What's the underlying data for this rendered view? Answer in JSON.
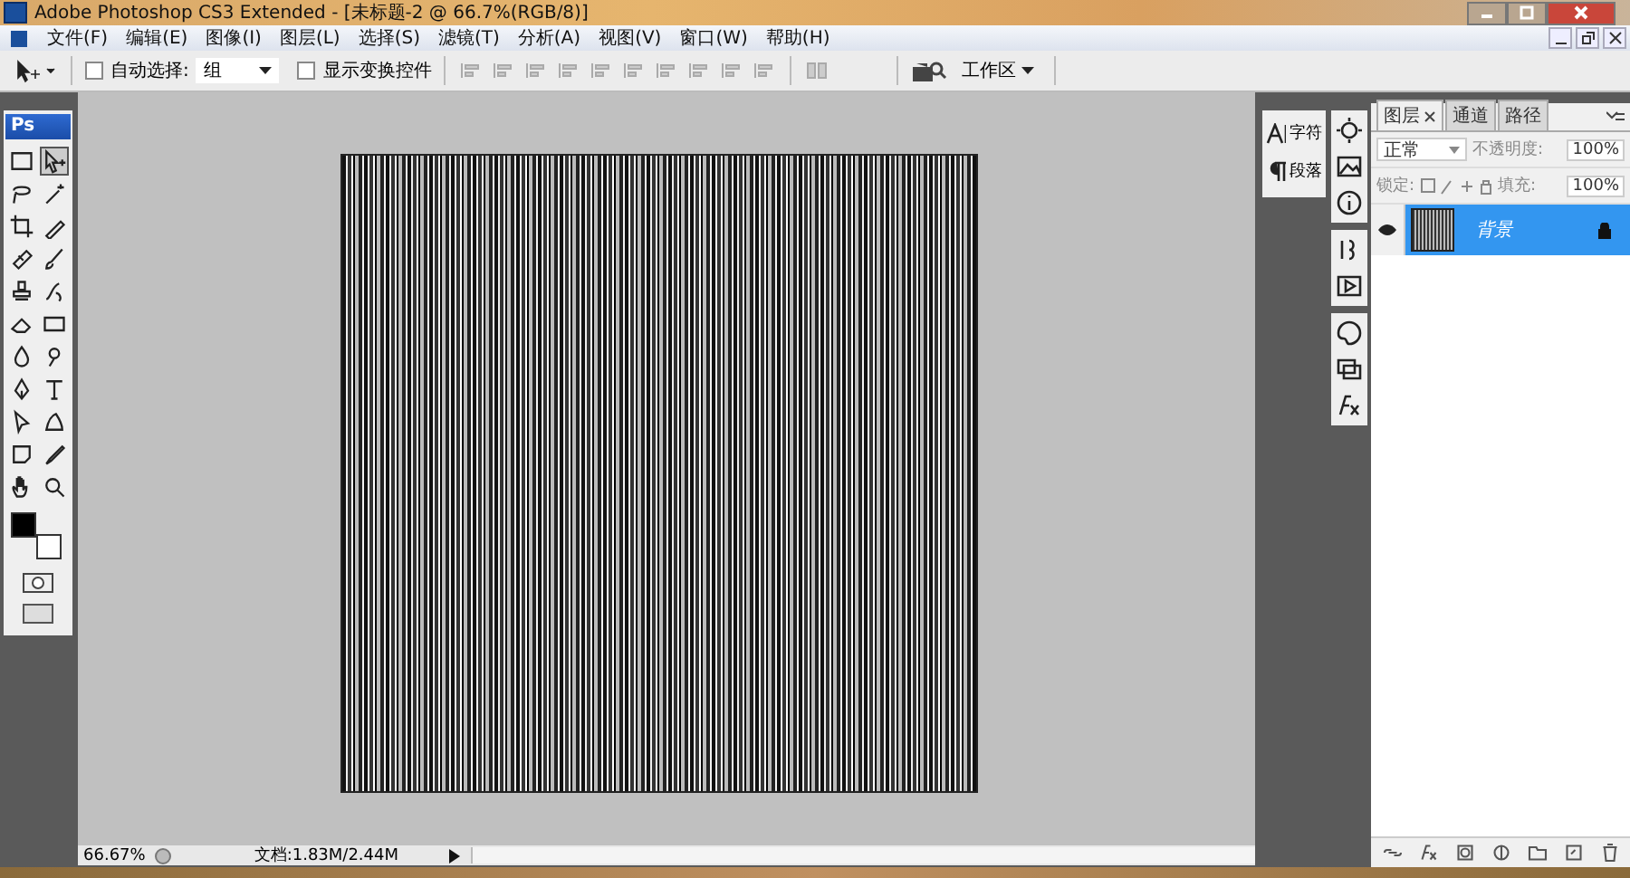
{
  "window": {
    "title": "Adobe Photoshop CS3 Extended - [未标题-2 @ 66.7%(RGB/8)]"
  },
  "menu": [
    "文件(F)",
    "编辑(E)",
    "图像(I)",
    "图层(L)",
    "选择(S)",
    "滤镜(T)",
    "分析(A)",
    "视图(V)",
    "窗口(W)",
    "帮助(H)"
  ],
  "options_bar": {
    "auto_select": {
      "label": "自动选择:",
      "checked": false
    },
    "target": {
      "value": "组"
    },
    "show_transform": {
      "label": "显示变换控件",
      "checked": false
    },
    "workspace": "工作区"
  },
  "toolbox": {
    "logo": "Ps",
    "tools": [
      {
        "kind": "marquee",
        "selected": false
      },
      {
        "kind": "move",
        "selected": true
      },
      {
        "kind": "lasso",
        "selected": false
      },
      {
        "kind": "wand",
        "selected": false
      },
      {
        "kind": "crop",
        "selected": false
      },
      {
        "kind": "slice",
        "selected": false
      },
      {
        "kind": "heal",
        "selected": false
      },
      {
        "kind": "brush",
        "selected": false
      },
      {
        "kind": "stamp",
        "selected": false
      },
      {
        "kind": "history",
        "selected": false
      },
      {
        "kind": "eraser",
        "selected": false
      },
      {
        "kind": "gradient",
        "selected": false
      },
      {
        "kind": "blur",
        "selected": false
      },
      {
        "kind": "dodge",
        "selected": false
      },
      {
        "kind": "pen",
        "selected": false
      },
      {
        "kind": "type",
        "selected": false
      },
      {
        "kind": "path",
        "selected": false
      },
      {
        "kind": "shape",
        "selected": false
      },
      {
        "kind": "notes",
        "selected": false
      },
      {
        "kind": "eyedropper",
        "selected": false
      },
      {
        "kind": "hand",
        "selected": false
      },
      {
        "kind": "zoom",
        "selected": false
      }
    ]
  },
  "mini_panels": [
    "字符",
    "段落"
  ],
  "layers_panel": {
    "tabs": [
      {
        "label": "图层",
        "selected": true
      },
      {
        "label": "通道",
        "selected": false
      },
      {
        "label": "路径",
        "selected": false
      }
    ],
    "blend_mode": "正常",
    "opacity_label": "不透明度:",
    "opacity": "100%",
    "lock_label": "锁定:",
    "fill_label": "填充:",
    "fill": "100%",
    "layers": [
      {
        "name": "背景",
        "selected": true,
        "visible": true,
        "locked": true
      }
    ]
  },
  "status_bar": {
    "zoom": "66.67%",
    "doc_info": "文档:1.83M/2.44M"
  }
}
